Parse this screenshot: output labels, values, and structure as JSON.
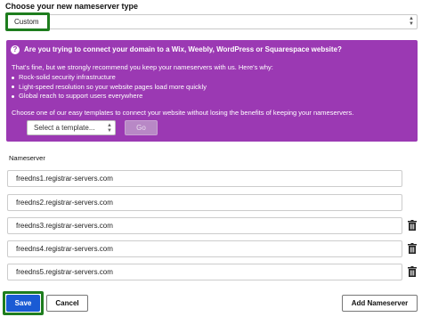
{
  "nameserver_type": {
    "heading": "Choose your new nameserver type",
    "selected": "Custom"
  },
  "promo": {
    "title": "Are you trying to connect your domain to a Wix, Weebly, WordPress or Squarespace website?",
    "intro": "That's fine, but we strongly recommend you keep your nameservers with us. Here's why:",
    "bullets": [
      "Rock-solid security infrastructure",
      "Light-speed resolution so your website pages load more quickly",
      "Global reach to support users everywhere"
    ],
    "choose_text": "Choose one of our easy templates to connect your website without losing the benefits of keeping your nameservers.",
    "template_placeholder": "Select a template...",
    "go_label": "Go",
    "background_color": "#9b39b3"
  },
  "nameservers": {
    "label": "Nameserver",
    "values": [
      "freedns1.registrar-servers.com",
      "freedns2.registrar-servers.com",
      "freedns3.registrar-servers.com",
      "freedns4.registrar-servers.com",
      "freedns5.registrar-servers.com"
    ],
    "delete_icon": "trash-icon"
  },
  "actions": {
    "save_label": "Save",
    "cancel_label": "Cancel",
    "add_label": "Add Nameserver",
    "save_color": "#1a5bd4",
    "highlight_color": "#1e7d1e"
  }
}
